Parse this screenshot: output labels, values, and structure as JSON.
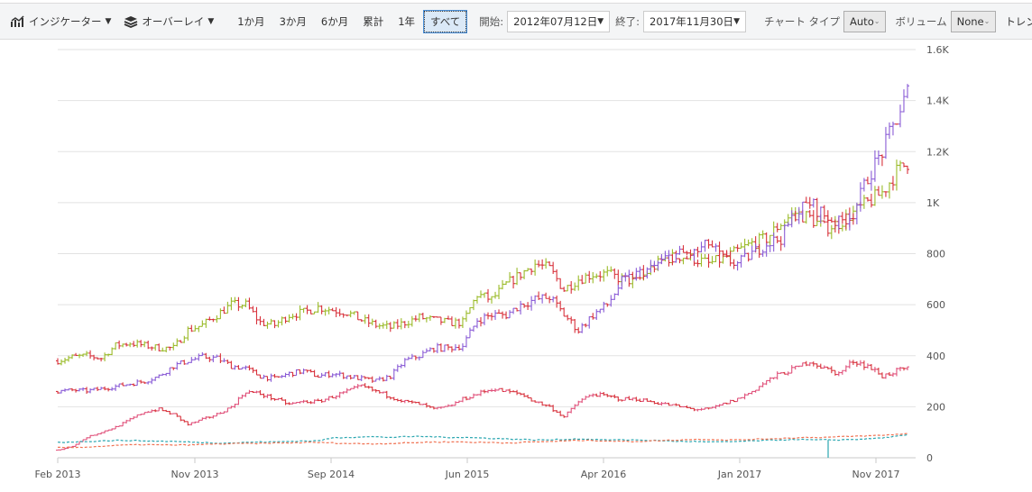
{
  "toolbar": {
    "indicator_label": "インジケーター",
    "overlay_label": "オーバーレイ",
    "periods": [
      "1か月",
      "3か月",
      "6か月",
      "累計",
      "1年",
      "すべて"
    ],
    "selected_period": "すべて",
    "start_label": "開始:",
    "start_value": "2012年07月12日",
    "end_label": "終了:",
    "end_value": "2017年11月30日",
    "chart_type_label": "チャート タイプ",
    "chart_type_value": "Auto",
    "volume_label": "ボリューム",
    "volume_value": "None",
    "trendline_label": "トレンドライン"
  },
  "chart_data": {
    "type": "ohlc",
    "x_ticks": [
      "Feb 2013",
      "Nov 2013",
      "Sep 2014",
      "Jun 2015",
      "Apr 2016",
      "Jan 2017",
      "Nov 2017"
    ],
    "y_ticks": [
      "0",
      "200",
      "400",
      "600",
      "800",
      "1K",
      "1.2K",
      "1.4K",
      "1.6K"
    ],
    "ylim": [
      0,
      1600
    ],
    "x_range": [
      "Feb 2013",
      "Dec 2017"
    ],
    "grid": true,
    "series": [
      {
        "name": "series-1",
        "style": "ohlc",
        "up": "#9bbb2a",
        "down": "#d8323c",
        "values": [
          380,
          395,
          400,
          390,
          440,
          450,
          440,
          430,
          430,
          500,
          520,
          560,
          600,
          600,
          530,
          520,
          560,
          570,
          590,
          580,
          570,
          540,
          520,
          510,
          530,
          550,
          540,
          530,
          530,
          640,
          620,
          680,
          720,
          760,
          740,
          660,
          700,
          720,
          720,
          700,
          690,
          740,
          780,
          790,
          780,
          760,
          780,
          810,
          840,
          860,
          920,
          960,
          940,
          900,
          920,
          960,
          1000,
          1040,
          1120,
          1170
        ]
      },
      {
        "name": "series-2",
        "style": "ohlc",
        "up": "#8a5cd6",
        "down": "#d8323c",
        "values": [
          260,
          265,
          262,
          270,
          280,
          290,
          300,
          320,
          360,
          380,
          395,
          390,
          360,
          350,
          320,
          310,
          330,
          340,
          320,
          330,
          320,
          310,
          300,
          320,
          380,
          400,
          430,
          430,
          440,
          540,
          560,
          560,
          600,
          620,
          630,
          560,
          500,
          560,
          600,
          690,
          720,
          740,
          780,
          800,
          800,
          840,
          780,
          760,
          800,
          840,
          860,
          960,
          1000,
          950,
          920,
          960,
          1100,
          1200,
          1330,
          1470
        ]
      },
      {
        "name": "series-3",
        "style": "ohlc",
        "up": "#e0507a",
        "down": "#d8323c",
        "values": [
          30,
          45,
          80,
          100,
          120,
          150,
          180,
          190,
          170,
          130,
          150,
          170,
          200,
          260,
          250,
          230,
          210,
          220,
          220,
          240,
          260,
          280,
          260,
          240,
          220,
          210,
          190,
          200,
          230,
          250,
          270,
          260,
          250,
          220,
          200,
          160,
          220,
          250,
          240,
          230,
          230,
          220,
          210,
          200,
          190,
          190,
          210,
          230,
          260,
          300,
          330,
          350,
          380,
          350,
          330,
          380,
          360,
          320,
          340,
          350
        ]
      },
      {
        "name": "series-4",
        "style": "dashed",
        "color": "#2aa6b0",
        "values": [
          60,
          62,
          64,
          66,
          68,
          68,
          66,
          65,
          64,
          62,
          60,
          58,
          58,
          60,
          62,
          62,
          64,
          66,
          66,
          78,
          80,
          82,
          82,
          80,
          82,
          84,
          82,
          80,
          80,
          78,
          76,
          74,
          72,
          70,
          70,
          72,
          74,
          72,
          70,
          70,
          70,
          68,
          66,
          64,
          64,
          62,
          62,
          64,
          66,
          68,
          70,
          72,
          70,
          70,
          70,
          72,
          74,
          78,
          84,
          90
        ]
      },
      {
        "name": "series-5",
        "style": "dashed",
        "color": "#f07050",
        "values": [
          40,
          40,
          42,
          45,
          48,
          50,
          52,
          50,
          50,
          50,
          52,
          54,
          55,
          56,
          56,
          58,
          58,
          60,
          60,
          58,
          56,
          55,
          55,
          56,
          58,
          60,
          62,
          62,
          62,
          60,
          60,
          58,
          60,
          62,
          64,
          66,
          68,
          68,
          66,
          64,
          64,
          66,
          68,
          70,
          72,
          72,
          70,
          70,
          72,
          74,
          76,
          78,
          80,
          80,
          82,
          84,
          86,
          88,
          92,
          95
        ]
      }
    ]
  }
}
